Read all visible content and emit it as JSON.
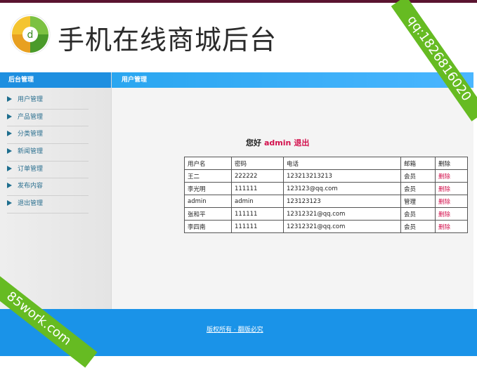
{
  "header": {
    "site_title": "手机在线商城后台"
  },
  "sidebar": {
    "title": "后台管理",
    "items": [
      {
        "label": "用户管理"
      },
      {
        "label": "产品管理"
      },
      {
        "label": "分类管理"
      },
      {
        "label": "新闻管理"
      },
      {
        "label": "订单管理"
      },
      {
        "label": "发布内容"
      },
      {
        "label": "退出管理"
      }
    ]
  },
  "main": {
    "section_title": "用户管理",
    "greeting": "您好",
    "username": "admin",
    "logout_label": "退出",
    "table": {
      "headers": [
        "用户名",
        "密码",
        "电话",
        "邮箱",
        "删除"
      ],
      "rows": [
        [
          "王二",
          "222222",
          "123213213213",
          "会员",
          "删除"
        ],
        [
          "李光明",
          "111111",
          "123123@qq.com",
          "会员",
          "删除"
        ],
        [
          "admin",
          "admin",
          "123123123",
          "管理",
          "删除"
        ],
        [
          "张和平",
          "111111",
          "12312321@qq.com",
          "会员",
          "删除"
        ],
        [
          "李四南",
          "111111",
          "12312321@qq.com",
          "会员",
          "删除"
        ]
      ]
    }
  },
  "footer": {
    "copyright": "版权所有 · 翻版必究"
  },
  "watermarks": {
    "top_right": "qq:1826816020",
    "bottom_left": "85work.com"
  },
  "colors": {
    "accent_blue": "#1e8fe0",
    "danger_red": "#d3104c",
    "ribbon_green": "#66bb22"
  }
}
